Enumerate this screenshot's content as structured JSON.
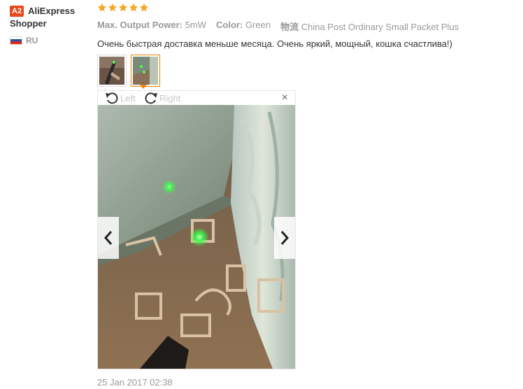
{
  "user": {
    "level_badge": "A2",
    "name_first": "AliExpress",
    "name_second": "Shopper",
    "country": "RU"
  },
  "review": {
    "rating": 5,
    "attributes": [
      {
        "label": "Max. Output Power:",
        "value": "5mW"
      },
      {
        "label": "Color:",
        "value": "Green"
      },
      {
        "label": "物流",
        "value": "China Post Ordinary Small Packet Plus"
      }
    ],
    "text": "Очень быстрая доставка меньше месяца. Очень яркий, мощный, кошка счастлива!)",
    "date": "25 Jan 2017 02:38"
  },
  "viewer": {
    "rotate_left_label": "Left",
    "rotate_right_label": "Right",
    "close_glyph": "×"
  },
  "colors": {
    "badge": "#e8491d",
    "star": "#f5a623",
    "active_thumb": "#f08000",
    "laser": "#3cff4a"
  }
}
